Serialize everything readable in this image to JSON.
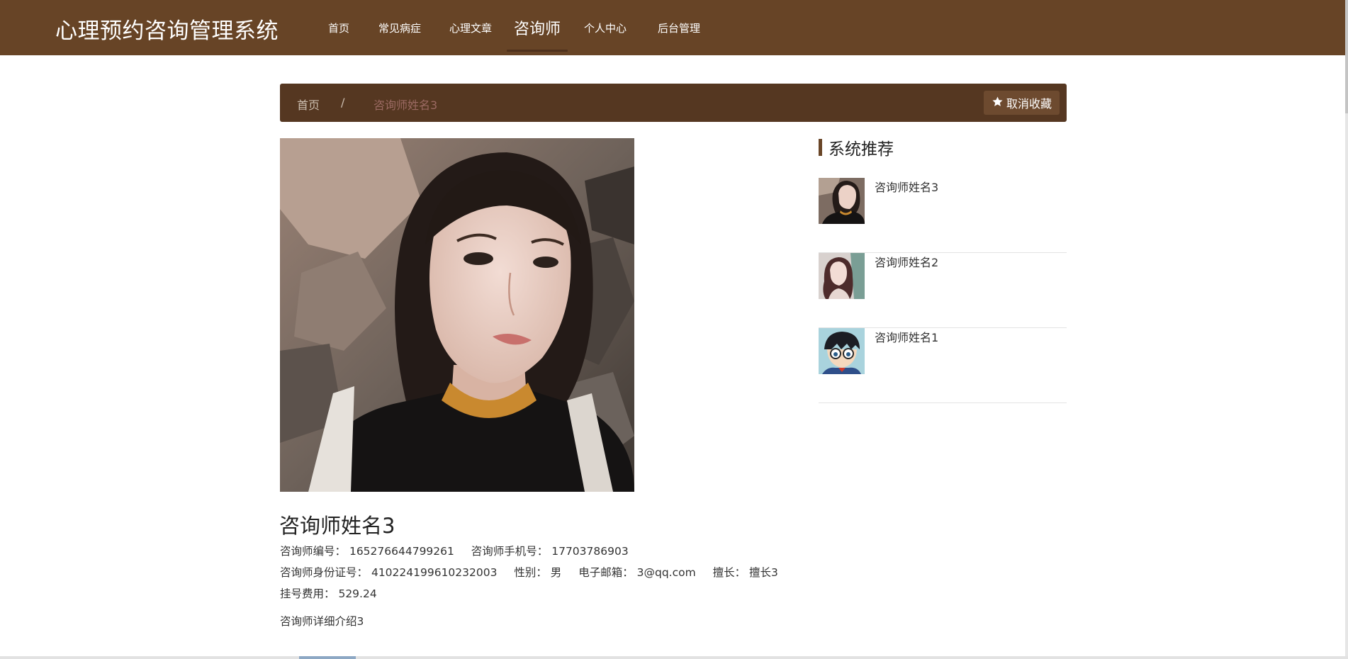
{
  "header": {
    "brand": "心理预约咨询管理系统",
    "nav": [
      {
        "label": "首页",
        "active": false
      },
      {
        "label": "常见病症",
        "active": false
      },
      {
        "label": "心理文章",
        "active": false
      },
      {
        "label": "咨询师",
        "active": true
      },
      {
        "label": "个人中心",
        "active": false
      },
      {
        "label": "后台管理",
        "active": false
      }
    ]
  },
  "breadcrumb": {
    "home": "首页",
    "separator": "/",
    "current": "咨询师姓名3",
    "favorite_button": "取消收藏",
    "favorite_icon": "star-icon"
  },
  "counselor": {
    "name": "咨询师姓名3",
    "id_label": "咨询师编号：",
    "id_value": "165276644799261",
    "phone_label": "咨询师手机号：",
    "phone_value": "17703786903",
    "idcard_label": "咨询师身份证号：",
    "idcard_value": "410224199610232003",
    "gender_label": "性别：",
    "gender_value": "男",
    "email_label": "电子邮箱：",
    "email_value": "3@qq.com",
    "specialty_label": "擅长：",
    "specialty_value": "擅长3",
    "fee_label": "挂号费用：",
    "fee_value": "529.24",
    "intro": "咨询师详细介绍3"
  },
  "recommend": {
    "title": "系统推荐",
    "items": [
      {
        "name": "咨询师姓名3"
      },
      {
        "name": "咨询师姓名2"
      },
      {
        "name": "咨询师姓名1"
      }
    ]
  },
  "colors": {
    "header_bg": "#674426",
    "crumb_bg": "#553721",
    "accent": "#6a4628"
  }
}
